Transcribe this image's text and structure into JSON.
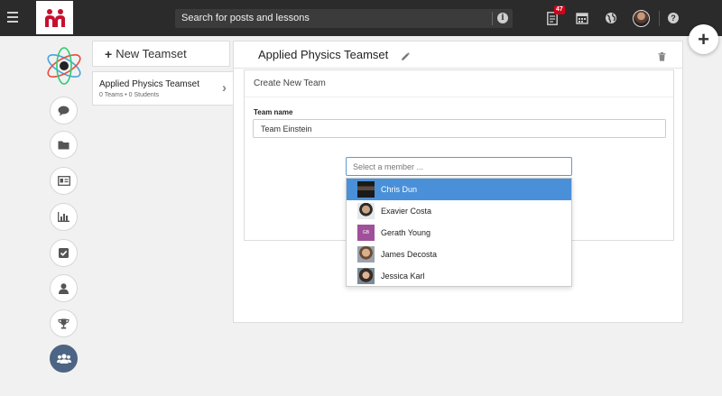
{
  "topbar": {
    "search_placeholder": "Search for posts and lessons",
    "notification_count": "47",
    "icons": [
      "menu-icon",
      "notifications-icon",
      "calendar-icon",
      "globe-icon",
      "profile-avatar",
      "help-icon"
    ]
  },
  "fab_label": "+",
  "sidebar": {
    "items": [
      "chat-icon",
      "folder-icon",
      "id-card-icon",
      "bar-chart-icon",
      "checkbox-icon",
      "user-icon",
      "trophy-icon",
      "users-icon"
    ],
    "active": "users-icon"
  },
  "teamsets": {
    "new_label": "New Teamset",
    "items": [
      {
        "name": "Applied Physics Teamset",
        "meta": "0 Teams • 0 Students"
      }
    ]
  },
  "main": {
    "title": "Applied Physics Teamset",
    "form": {
      "heading": "Create New Team",
      "team_name_label": "Team name",
      "team_name_value": "Team Einstein",
      "member_placeholder": "Select a member ..."
    }
  },
  "members": [
    {
      "name": "Chris Dun",
      "selected": true
    },
    {
      "name": "Exavier Costa",
      "selected": false
    },
    {
      "name": "Gerath Young",
      "selected": false,
      "initials": "GB"
    },
    {
      "name": "James Decosta",
      "selected": false
    },
    {
      "name": "Jessica Karl",
      "selected": false
    }
  ],
  "colors": {
    "topbar": "#2b2b2b",
    "brand_red": "#d0021b",
    "accent_blue": "#4a90d9",
    "sidebar_active": "#4d6584"
  }
}
